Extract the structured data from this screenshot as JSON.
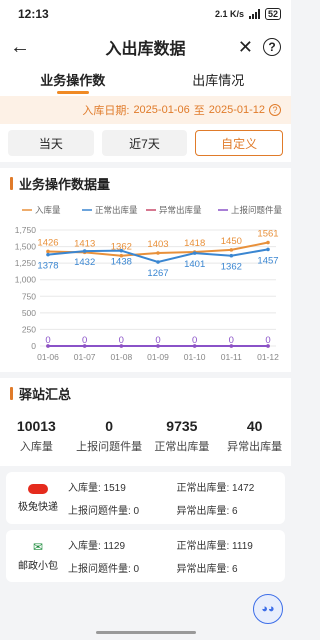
{
  "status_bar": {
    "time": "12:13",
    "network": "2.1 K/s",
    "battery": "52"
  },
  "nav": {
    "title": "入出库数据",
    "back_icon": "arrow-left-icon",
    "close_icon": "close-icon",
    "help_icon": "help-icon",
    "help_glyph": "?"
  },
  "tabs": [
    {
      "label": "业务操作数",
      "active": true
    },
    {
      "label": "出库情况",
      "active": false
    }
  ],
  "date_range": {
    "label": "入库日期:",
    "start": "2025-01-06",
    "sep": "至",
    "end": "2025-01-12",
    "help_glyph": "?"
  },
  "range_buttons": [
    {
      "label": "当天"
    },
    {
      "label": "近7天"
    },
    {
      "label": "自定义",
      "active": true
    }
  ],
  "ops_section": {
    "title": "业务操作数据量"
  },
  "chart_data": {
    "type": "line",
    "categories": [
      "01-06",
      "01-07",
      "01-08",
      "01-09",
      "01-10",
      "01-11",
      "01-12"
    ],
    "ylim": [
      0,
      1750
    ],
    "yticks": [
      0,
      250,
      500,
      750,
      1000,
      1250,
      1500,
      1750
    ],
    "ytick_labels": [
      "0",
      "250",
      "500",
      "750",
      "1,000",
      "1,250",
      "1,500",
      "1,750"
    ],
    "grid": true,
    "legend_position": "top",
    "series": [
      {
        "name": "入库量",
        "color": "#e8903a",
        "values": [
          1426,
          1413,
          1362,
          1403,
          1418,
          1450,
          1561
        ],
        "label_pos": "above"
      },
      {
        "name": "正常出库量",
        "color": "#3a86d1",
        "values": [
          1378,
          1432,
          1438,
          1267,
          1401,
          1362,
          1457
        ],
        "label_pos": "below"
      },
      {
        "name": "异常出库量",
        "color": "#c84a6a",
        "values": [
          0,
          0,
          0,
          0,
          0,
          0,
          0
        ],
        "label_pos": "none"
      },
      {
        "name": "上报问题件量",
        "color": "#8a52c8",
        "values": [
          0,
          0,
          0,
          0,
          0,
          0,
          0
        ],
        "label_pos": "on"
      }
    ]
  },
  "station_section": {
    "title": "驿站汇总"
  },
  "summary": [
    {
      "value": "10013",
      "label": "入库量"
    },
    {
      "value": "0",
      "label": "上报问题件量"
    },
    {
      "value": "9735",
      "label": "正常出库量"
    },
    {
      "value": "40",
      "label": "异常出库量"
    }
  ],
  "stations": [
    {
      "name": "极兔快递",
      "logo_text": "J&T EXPRESS",
      "in": "入库量: 1519",
      "normal_out": "正常出库量: 1472",
      "report": "上报问题件量: 0",
      "abnormal_out": "异常出库量: 6"
    },
    {
      "name": "邮政小包",
      "logo_text": "中国邮政",
      "in": "入库量: 1129",
      "normal_out": "正常出库量: 1119",
      "report": "上报问题件量: 0",
      "abnormal_out": "异常出库量: 6"
    }
  ]
}
